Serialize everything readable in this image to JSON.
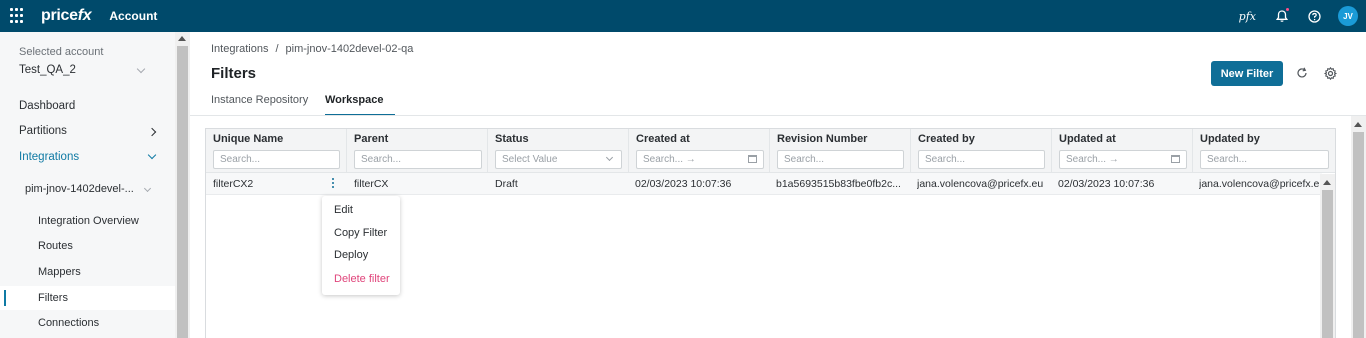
{
  "topbar": {
    "logo": "pricefx",
    "logo_main": "price",
    "logo_fx": "fx",
    "app_name": "Account",
    "pfx_label": "pfx",
    "avatar_initials": "JV",
    "icons": [
      "apps-grid-icon",
      "bell-icon",
      "help-icon"
    ],
    "colors": {
      "bar": "#004a6b",
      "avatar": "#1a9bd7",
      "notification": "#ff4f8b"
    }
  },
  "sidebar": {
    "selected_account_label": "Selected account",
    "selected_account_value": "Test_QA_2",
    "nav": [
      {
        "label": "Dashboard"
      },
      {
        "label": "Partitions",
        "icon": "chevron-right-icon"
      },
      {
        "label": "Integrations",
        "icon": "chevron-down-icon",
        "expanded": true
      }
    ],
    "instance": "pim-jnov-1402devel-...",
    "sub_items": [
      {
        "label": "Integration Overview"
      },
      {
        "label": "Routes"
      },
      {
        "label": "Mappers"
      },
      {
        "label": "Filters",
        "active": true
      },
      {
        "label": "Connections"
      }
    ]
  },
  "main": {
    "breadcrumb": [
      "Integrations",
      "pim-jnov-1402devel-02-qa"
    ],
    "breadcrumb_sep": "/",
    "title": "Filters",
    "new_button": "New Filter",
    "tabs": [
      {
        "label": "Instance Repository",
        "active": false
      },
      {
        "label": "Workspace",
        "active": true
      }
    ],
    "accent_color": "#0f6e97"
  },
  "table": {
    "columns": [
      {
        "title": "Unique Name",
        "filter": "Search...",
        "filter_type": "text"
      },
      {
        "title": "Parent",
        "filter": "Search...",
        "filter_type": "text"
      },
      {
        "title": "Status",
        "filter": "Select Value",
        "filter_type": "select"
      },
      {
        "title": "Created at",
        "filter": "Search... →",
        "filter_type": "date"
      },
      {
        "title": "Revision Number",
        "filter": "Search...",
        "filter_type": "text"
      },
      {
        "title": "Created by",
        "filter": "Search...",
        "filter_type": "text"
      },
      {
        "title": "Updated at",
        "filter": "Search... →",
        "filter_type": "date"
      },
      {
        "title": "Updated by",
        "filter": "Search...",
        "filter_type": "text"
      }
    ],
    "rows": [
      {
        "unique_name": "filterCX2",
        "parent": "filterCX",
        "status": "Draft",
        "created_at": "02/03/2023 10:07:36",
        "revision_number": "b1a5693515b83fbe0fb2c...",
        "created_by": "jana.volencova@pricefx.eu",
        "updated_at": "02/03/2023 10:07:36",
        "updated_by": "jana.volencova@pricefx.eu"
      }
    ]
  },
  "context_menu": {
    "items": [
      {
        "label": "Edit"
      },
      {
        "label": "Copy Filter"
      },
      {
        "label": "Deploy"
      },
      {
        "label": "Delete filter",
        "danger": true
      }
    ]
  }
}
